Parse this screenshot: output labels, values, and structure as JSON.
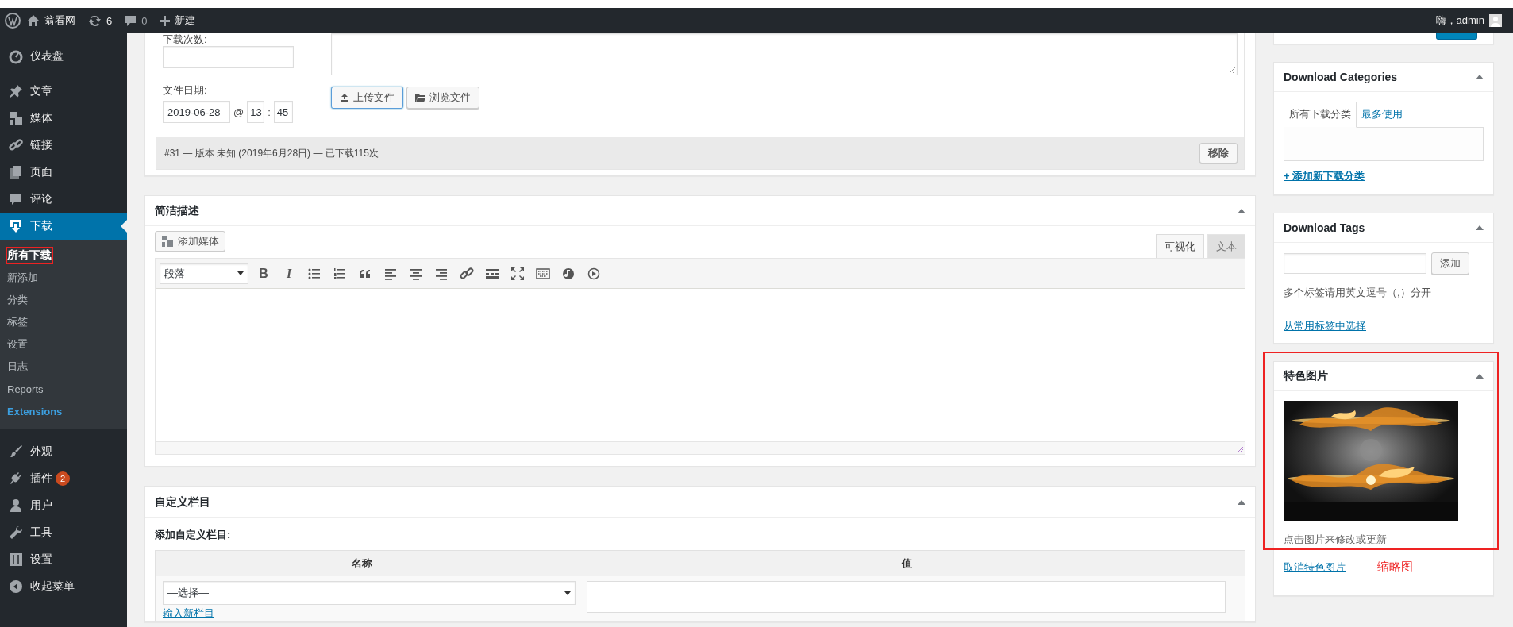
{
  "admin_bar": {
    "site": "翁看网",
    "updates": "6",
    "comments": "0",
    "new": "新建",
    "greeting": "嗨，admin"
  },
  "menu": [
    {
      "label": "仪表盘",
      "kind": "dashboard",
      "current": false
    },
    {
      "label": "文章",
      "kind": "pin",
      "current": false
    },
    {
      "label": "媒体",
      "kind": "media",
      "current": false
    },
    {
      "label": "链接",
      "kind": "link",
      "current": false
    },
    {
      "label": "页面",
      "kind": "page",
      "current": false
    },
    {
      "label": "评论",
      "kind": "comment",
      "current": false
    },
    {
      "label": "下载",
      "kind": "download",
      "current": true,
      "children": [
        {
          "label": "所有下载",
          "selected": true,
          "annotated": true,
          "kind": "normal"
        },
        {
          "label": "新添加",
          "selected": false,
          "annotated": false,
          "kind": "normal"
        },
        {
          "label": "分类",
          "selected": false,
          "annotated": false,
          "kind": "normal"
        },
        {
          "label": "标签",
          "selected": false,
          "annotated": false,
          "kind": "normal"
        },
        {
          "label": "设置",
          "selected": false,
          "annotated": false,
          "kind": "normal"
        },
        {
          "label": "日志",
          "selected": false,
          "annotated": false,
          "kind": "normal"
        },
        {
          "label": "Reports",
          "selected": false,
          "annotated": false,
          "kind": "normal"
        },
        {
          "label": "Extensions",
          "selected": false,
          "annotated": false,
          "kind": "accent"
        }
      ]
    },
    {
      "label": "外观",
      "kind": "brush",
      "current": false
    },
    {
      "label": "插件",
      "kind": "plug",
      "current": false,
      "badge": "2"
    },
    {
      "label": "用户",
      "kind": "user",
      "current": false
    },
    {
      "label": "工具",
      "kind": "wrench",
      "current": false
    },
    {
      "label": "设置",
      "kind": "sliders",
      "current": false
    },
    {
      "label": "收起菜单",
      "kind": "collapse",
      "current": false
    }
  ],
  "file_box": {
    "count_label": "下载次数:",
    "date_label": "文件日期:",
    "date": "2019-06-28",
    "at": "@",
    "hour": "13",
    "separator": ":",
    "minute": "45",
    "upload": "上传文件",
    "browse": "浏览文件",
    "summary": "#31 — 版本 未知 (2019年6月28日) — 已下载115次",
    "remove": "移除"
  },
  "excerpt": {
    "title": "简洁描述",
    "add_media": "添加媒体",
    "tabs": [
      {
        "label": "可视化",
        "selected": true
      },
      {
        "label": "文本",
        "selected": false
      }
    ],
    "format": "段落",
    "toolbar": [
      {
        "kind": "bold",
        "label": "B"
      },
      {
        "kind": "italic",
        "label": "I"
      },
      {
        "kind": "bullets"
      },
      {
        "kind": "numbers"
      },
      {
        "kind": "quote"
      },
      {
        "kind": "align-left"
      },
      {
        "kind": "align-center"
      },
      {
        "kind": "align-right"
      },
      {
        "kind": "link"
      },
      {
        "kind": "more"
      },
      {
        "kind": "fullscreen"
      },
      {
        "kind": "keyboard"
      },
      {
        "kind": "audio"
      },
      {
        "kind": "video"
      }
    ]
  },
  "custom_fields": {
    "title": "自定义栏目",
    "add_label": "添加自定义栏目:",
    "columns": [
      "名称",
      "值"
    ],
    "select": "—选择—",
    "new_link": "输入新栏目"
  },
  "sidebar": {
    "categories": {
      "title": "Download Categories",
      "tabs": [
        {
          "label": "所有下载分类",
          "selected": true
        },
        {
          "label": "最多使用",
          "selected": false
        }
      ],
      "add_link": "+ 添加新下载分类"
    },
    "tags": {
      "title": "Download Tags",
      "add": "添加",
      "hint": "多个标签请用英文逗号（,）分开",
      "choose": "从常用标签中选择"
    },
    "featured": {
      "title": "特色图片",
      "annotated": true,
      "hint": "点击图片来修改或更新",
      "remove": "取消特色图片",
      "note": "缩略图"
    }
  }
}
